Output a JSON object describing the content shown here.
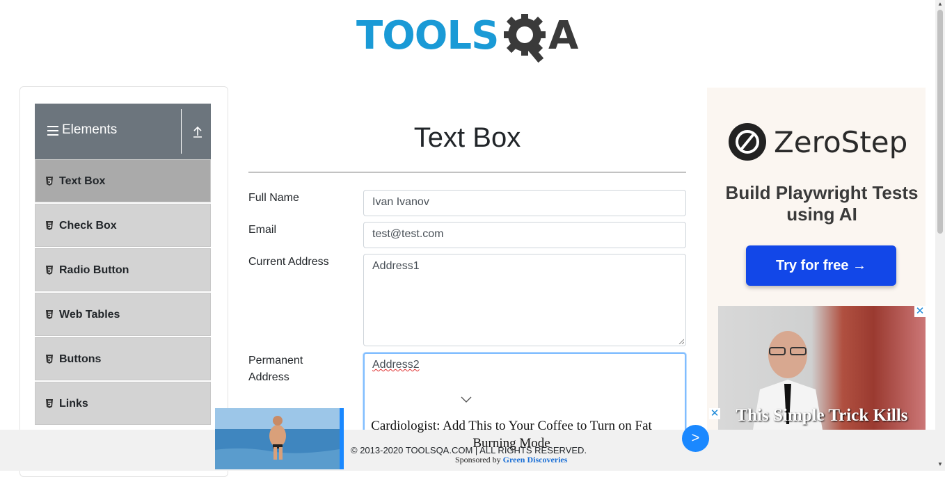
{
  "header": {
    "logo_text": "TOOLS",
    "logo_text_end": "A"
  },
  "sidebar": {
    "group_title": "Elements",
    "items": [
      {
        "label": "Text Box"
      },
      {
        "label": "Check Box"
      },
      {
        "label": "Radio Button"
      },
      {
        "label": "Web Tables"
      },
      {
        "label": "Buttons"
      },
      {
        "label": "Links"
      }
    ]
  },
  "main": {
    "title": "Text Box",
    "fields": {
      "full_name": {
        "label": "Full Name",
        "value": "Ivan Ivanov"
      },
      "email": {
        "label": "Email",
        "value": "test@test.com"
      },
      "current_address": {
        "label": "Current Address",
        "value": "Address1"
      },
      "permanent_address": {
        "label": "Permanent Address",
        "value": "Address2"
      }
    }
  },
  "ad_right": {
    "brand": "ZeroStep",
    "headline": "Build Playwright Tests using AI",
    "cta": "Try for free →",
    "image_caption": "This Simple Trick Kills"
  },
  "ad_bottom": {
    "headline": "Cardiologist: Add This to Your Coffee to Turn on Fat Burning Mode",
    "sponsor_prefix": "Sponsored by",
    "sponsor_name": "Green Discoveries",
    "next_label": ">"
  },
  "footer": {
    "copyright": "© 2013-2020 TOOLSQA.COM | ALL RIGHTS RESERVED."
  },
  "colors": {
    "sidebar_header": "#6c757d",
    "active_item": "#aaaaaa",
    "item_bg": "#d3d3d3",
    "focus_border": "#80bdff",
    "ad_blue": "#1247e8"
  }
}
